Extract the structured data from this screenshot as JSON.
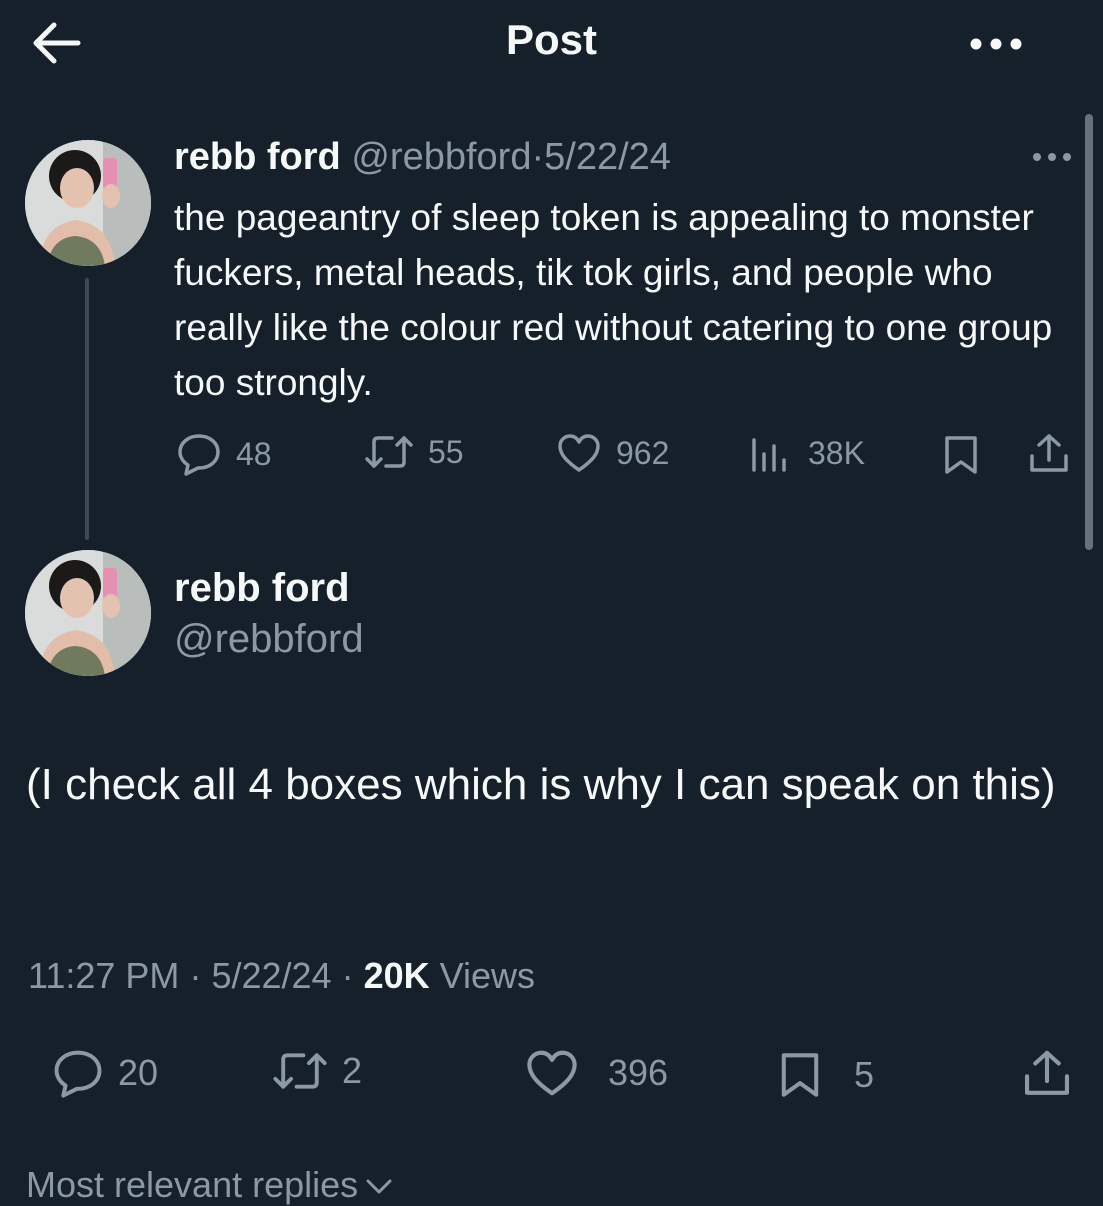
{
  "header": {
    "title": "Post",
    "back_icon": "arrow-left-icon",
    "more_icon": "more-horizontal-icon"
  },
  "parent_tweet": {
    "display_name": "rebb ford",
    "handle": "@rebbford",
    "separator": "·",
    "date": "5/22/24",
    "text": "the pageantry of sleep token is appealing to monster fuckers, metal heads, tik tok girls, and people who really like the colour red without catering to one group too strongly.",
    "replies": "48",
    "reposts": "55",
    "likes": "962",
    "views": "38K"
  },
  "main_tweet": {
    "display_name": "rebb ford",
    "handle": "@rebbford",
    "text": "(I check all 4 boxes which is why I can speak on this)",
    "time": "11:27 PM",
    "sep1": "·",
    "date": "5/22/24",
    "sep2": "·",
    "views_count": "20K",
    "views_label": "Views",
    "replies": "20",
    "reposts": "2",
    "likes": "396",
    "bookmarks": "5"
  },
  "replies_sort": {
    "label": "Most relevant replies"
  },
  "colors": {
    "background": "#15202b",
    "text": "#f7f9f9",
    "muted": "#8b98a5",
    "thread_line": "#3c4954"
  }
}
